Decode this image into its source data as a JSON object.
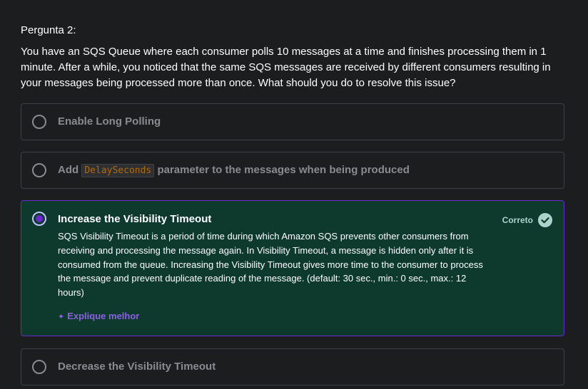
{
  "question": {
    "number_label": "Pergunta 2:",
    "text": "You have an SQS Queue where each consumer polls 10 messages at a time and finishes processing them in 1 minute. After a while, you noticed that the same SQS messages are received by different consumers resulting in your messages being processed more than once. What should you do to resolve this issue?"
  },
  "options": [
    {
      "label": "Enable Long Polling",
      "selected": false
    },
    {
      "label_prefix": "Add",
      "code": "DelaySeconds",
      "label_suffix": "parameter to the messages when being produced",
      "selected": false
    },
    {
      "label": "Increase the Visibility Timeout",
      "selected": true,
      "status": "Correto",
      "explanation": "SQS Visibility Timeout is a period of time during which Amazon SQS prevents other consumers from receiving and processing the message again. In Visibility Timeout, a message is hidden only after it is consumed from the queue. Increasing the Visibility Timeout gives more time to the consumer to process the message and prevent duplicate reading of the message. (default: 30 sec., min.: 0 sec., max.: 12 hours)",
      "explain_link": "Explique melhor"
    },
    {
      "label": "Decrease the Visibility Timeout",
      "selected": false
    }
  ],
  "icons": {
    "correct": "check-circle-icon",
    "sparkle": "sparkle-icon"
  },
  "colors": {
    "background": "#1c1d1f",
    "correct_bg": "#0d3a2c",
    "accent_purple": "#6d28d2",
    "link_purple": "#8c5fe6",
    "correct_green": "#acd2cc",
    "code_orange": "#b4690e"
  }
}
